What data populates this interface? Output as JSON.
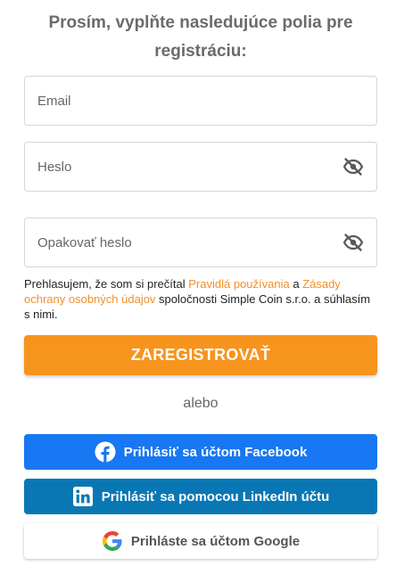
{
  "form": {
    "heading": "Prosím, vyplňte nasledujúce polia pre registráciu:",
    "email_placeholder": "Email",
    "password_placeholder": "Heslo",
    "repeat_password_placeholder": "Opakovať heslo",
    "consent": {
      "prefix": "Prehlasujem, že som si prečítal ",
      "terms_link": "Pravidlá používania",
      "middle": " a ",
      "privacy_link": "Zásady ochrany osobných údajov",
      "suffix": " spoločnosti Simple Coin s.r.o. a súhlasím s nimi."
    },
    "register_label": "ZAREGISTROVAŤ",
    "or_label": "alebo",
    "facebook_label": "Prihlásiť sa účtom Facebook",
    "linkedin_label": "Prihlásiť sa pomocou LinkedIn účtu",
    "google_label": "Prihláste sa účtom Google"
  },
  "colors": {
    "accent": "#f7941d",
    "link": "#f0902a",
    "facebook": "#1877f2",
    "linkedin": "#0a77b5"
  },
  "icons": {
    "password_toggle": "eye-off-icon",
    "repeat_password_toggle": "eye-off-icon",
    "facebook": "facebook-icon",
    "linkedin": "linkedin-icon",
    "google": "google-icon"
  }
}
